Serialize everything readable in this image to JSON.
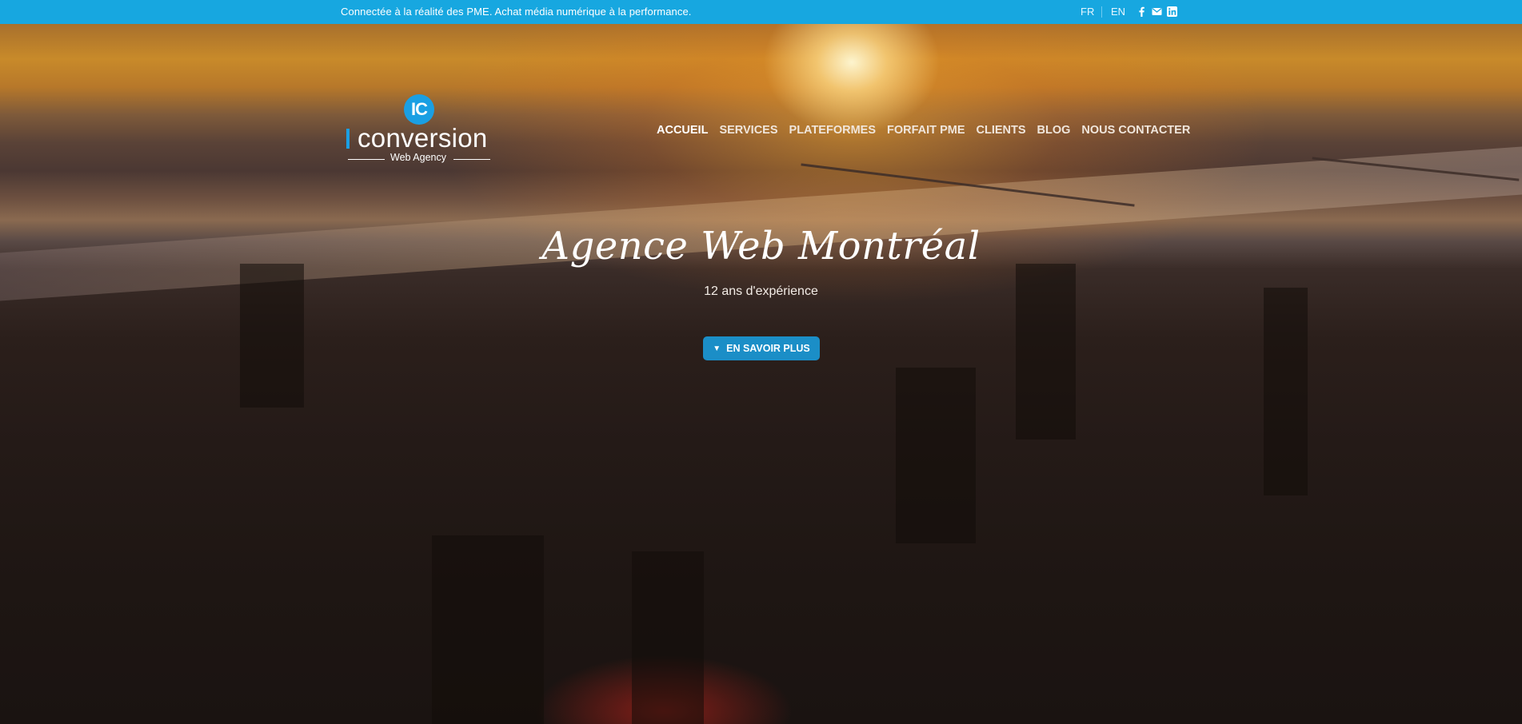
{
  "topbar": {
    "tagline": "Connectée à la réalité des PME. Achat média numérique à la performance.",
    "lang_fr": "FR",
    "lang_en": "EN",
    "social_icons": [
      "facebook-icon",
      "mail-icon",
      "linkedin-icon"
    ],
    "background_color": "#17a7e0"
  },
  "logo": {
    "badge": "IC",
    "word": "conversion",
    "subtitle": "Web Agency",
    "accent_color": "#1a9fe3"
  },
  "nav": {
    "items": [
      {
        "label": "ACCUEIL",
        "active": true
      },
      {
        "label": "SERVICES",
        "active": false
      },
      {
        "label": "PLATEFORMES",
        "active": false
      },
      {
        "label": "FORFAIT PME",
        "active": false
      },
      {
        "label": "CLIENTS",
        "active": false
      },
      {
        "label": "BLOG",
        "active": false
      },
      {
        "label": "NOUS CONTACTER",
        "active": false
      }
    ]
  },
  "hero": {
    "headline": "Agence Web Montréal",
    "subheadline": "12 ans d'expérience",
    "cta_label": "EN SAVOIR PLUS",
    "cta_icon": "chevron-down-icon",
    "cta_color": "#1b8ec7"
  }
}
